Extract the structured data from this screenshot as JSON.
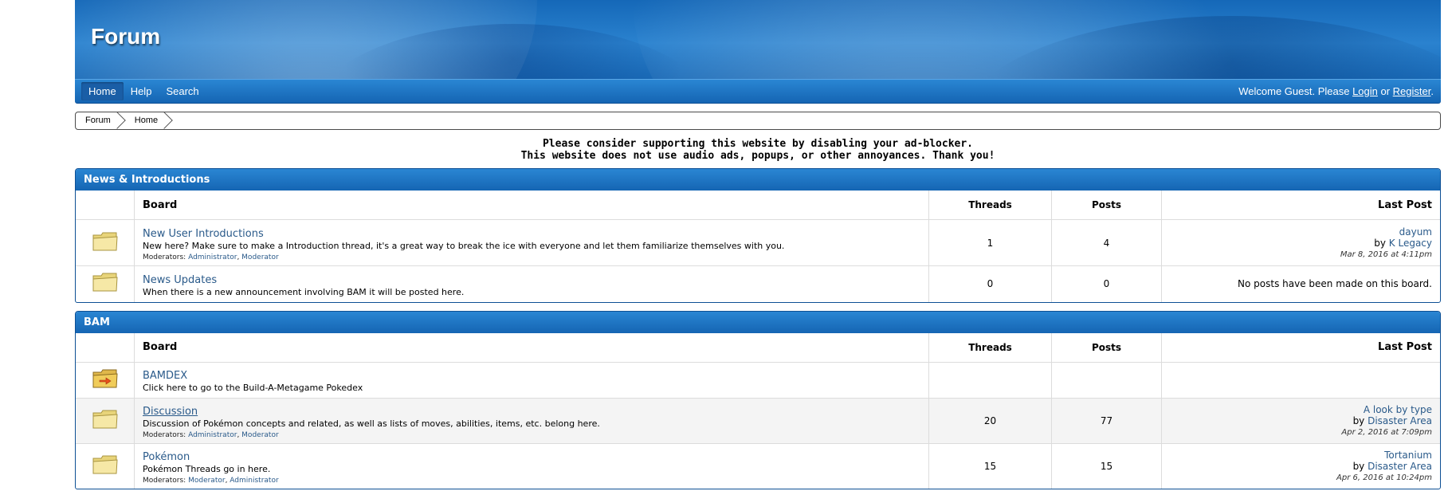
{
  "header": {
    "logo": "Forum"
  },
  "nav": {
    "items": [
      "Home",
      "Help",
      "Search"
    ],
    "welcome_prefix": "Welcome Guest. Please ",
    "login": "Login",
    "or": " or ",
    "register": "Register",
    "suffix": "."
  },
  "breadcrumb": [
    "Forum",
    "Home"
  ],
  "notice": {
    "line1": "Please consider supporting this website by disabling your ad-blocker.",
    "line2": "This website does not use audio ads, popups, or other annoyances. Thank you!"
  },
  "columns": {
    "board": "Board",
    "threads": "Threads",
    "posts": "Posts",
    "last_post": "Last Post"
  },
  "moderators_label": "Moderators:",
  "categories": [
    {
      "title": "News & Introductions",
      "boards": [
        {
          "name": "New User Introductions",
          "description": "New here? Make sure to make a Introduction thread, it's a great way to break the ice with everyone and let them familiarize themselves with you.",
          "moderators": [
            "Administrator",
            "Moderator"
          ],
          "threads": "1",
          "posts": "4",
          "last_post": {
            "title": "dayum",
            "by_prefix": "by ",
            "by": "K Legacy",
            "date": "Mar 8, 2016 at 4:11pm"
          }
        },
        {
          "name": "News Updates",
          "description": "When there is a new announcement involving BAM it will be posted here.",
          "threads": "0",
          "posts": "0",
          "last_post_text": "No posts have been made on this board."
        }
      ]
    },
    {
      "title": "BAM",
      "boards": [
        {
          "name": "BAMDEX",
          "description": "Click here to go to the Build-A-Metagame Pokedex",
          "redirect": true
        },
        {
          "name": "Discussion",
          "description": "Discussion of Pokémon concepts and related, as well as lists of moves, abilities, items, etc. belong here.",
          "moderators": [
            "Administrator",
            "Moderator"
          ],
          "threads": "20",
          "posts": "77",
          "last_post": {
            "title": "A look by type",
            "by_prefix": "by ",
            "by": "Disaster Area",
            "date": "Apr 2, 2016 at 7:09pm"
          }
        },
        {
          "name": "Pokémon",
          "description": "Pokémon Threads go in here.",
          "moderators": [
            "Moderator",
            "Administrator"
          ],
          "threads": "15",
          "posts": "15",
          "last_post": {
            "title": "Tortanium",
            "by_prefix": "by ",
            "by": "Disaster Area",
            "date": "Apr 6, 2016 at 10:24pm"
          }
        }
      ]
    }
  ],
  "colors": {
    "blue": "#1a6bb8",
    "link": "#2a5a8a",
    "border": "#dcdcdc"
  }
}
